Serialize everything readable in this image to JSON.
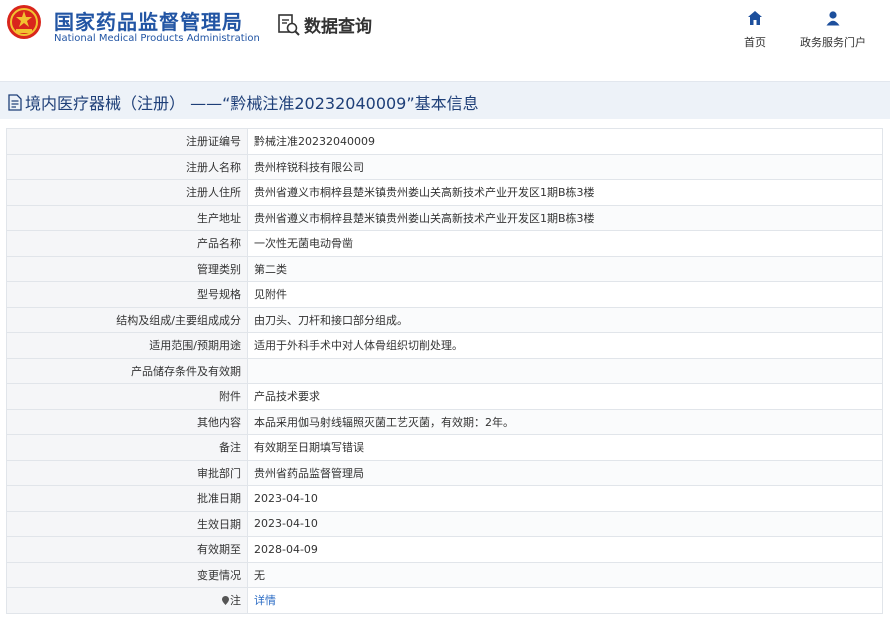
{
  "header": {
    "org_name_cn": "国家药品监督管理局",
    "org_name_en": "National Medical Products Administration",
    "query_label": "数据查询",
    "nav": [
      {
        "label": "首页",
        "icon": "home-icon"
      },
      {
        "label": "政务服务门户",
        "icon": "user-icon"
      }
    ]
  },
  "title": "境内医疗器械（注册） ——“黔械注准20232040009”基本信息",
  "colors": {
    "brand_blue": "#2255a4",
    "title_band": "#edf2f8",
    "link": "#2a6bc4",
    "logo_red": "#d9261c"
  },
  "rows": [
    {
      "label": "注册证编号",
      "value": "黔械注准20232040009"
    },
    {
      "label": "注册人名称",
      "value": "贵州梓锐科技有限公司"
    },
    {
      "label": "注册人住所",
      "value": "贵州省遵义市桐梓县楚米镇贵州娄山关高新技术产业开发区1期B栋3楼"
    },
    {
      "label": "生产地址",
      "value": "贵州省遵义市桐梓县楚米镇贵州娄山关高新技术产业开发区1期B栋3楼"
    },
    {
      "label": "产品名称",
      "value": "一次性无菌电动骨凿"
    },
    {
      "label": "管理类别",
      "value": "第二类"
    },
    {
      "label": "型号规格",
      "value": "见附件"
    },
    {
      "label": "结构及组成/主要组成成分",
      "value": "由刀头、刀杆和接口部分组成。"
    },
    {
      "label": "适用范围/预期用途",
      "value": "适用于外科手术中对人体骨组织切削处理。"
    },
    {
      "label": "产品储存条件及有效期",
      "value": ""
    },
    {
      "label": "附件",
      "value": "产品技术要求"
    },
    {
      "label": "其他内容",
      "value": "本品采用伽马射线辐照灭菌工艺灭菌，有效期：2年。"
    },
    {
      "label": "备注",
      "value": "有效期至日期填写错误"
    },
    {
      "label": "审批部门",
      "value": "贵州省药品监督管理局"
    },
    {
      "label": "批准日期",
      "value": "2023-04-10"
    },
    {
      "label": "生效日期",
      "value": "2023-04-10"
    },
    {
      "label": "有效期至",
      "value": "2028-04-09"
    },
    {
      "label": "变更情况",
      "value": "无"
    },
    {
      "label": "注",
      "value": "详情",
      "icon": "pin-icon"
    }
  ]
}
